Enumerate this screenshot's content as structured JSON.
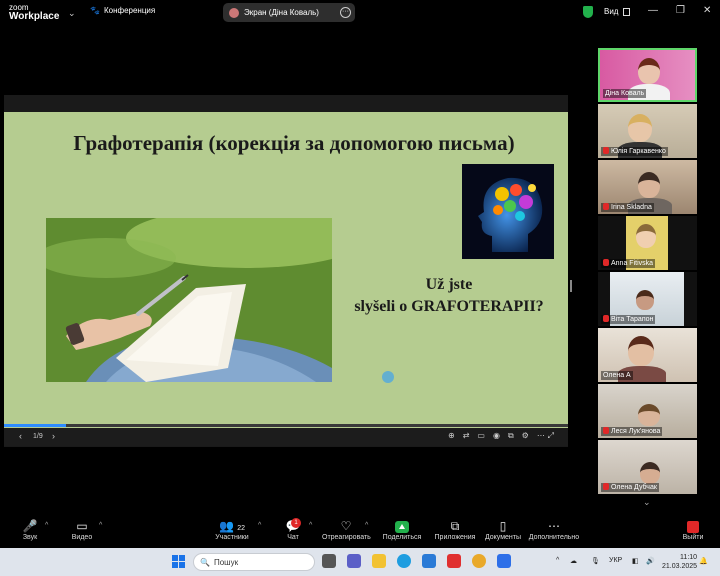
{
  "app": {
    "logo_line1": "zoom",
    "logo_line2": "Workplace",
    "meeting_label": "Конференция",
    "screen_share_label": "Экран (Діна Коваль)",
    "view_label": "Вид"
  },
  "slide": {
    "title": "Графотерапія (корекція за допомогою письма)",
    "question_line1": "Už jste",
    "question_line2": "slyšeli o GRAFOTERAPII?",
    "page_indicator": "1/9",
    "progress_fraction": 0.11
  },
  "participants": [
    {
      "name": "Діна Коваль",
      "muted": false,
      "active": true
    },
    {
      "name": "Юлія Гаркавенко",
      "muted": true,
      "active": false
    },
    {
      "name": "Irina Skladna",
      "muted": true,
      "active": false
    },
    {
      "name": "Anna Fitivska",
      "muted": true,
      "active": false
    },
    {
      "name": "Віта Тарапон",
      "muted": true,
      "active": false
    },
    {
      "name": "Олена А",
      "muted": false,
      "active": false
    },
    {
      "name": "Леся Лук'янова",
      "muted": true,
      "active": false
    },
    {
      "name": "Олена Дубчак",
      "muted": true,
      "active": false
    }
  ],
  "toolbar": {
    "audio": "Звук",
    "video": "Видео",
    "participants": "Участники",
    "participants_count": "22",
    "chat": "Чат",
    "chat_badge": "1",
    "react": "Отреагировать",
    "share": "Поделиться",
    "apps": "Приложения",
    "docs": "Документы",
    "more": "Дополнительно",
    "leave": "Выйти"
  },
  "taskbar": {
    "search_placeholder": "Пошук",
    "language": "УКР",
    "time": "11:10",
    "date": "21.03.2025"
  },
  "colors": {
    "slide_background": "#b5cc90",
    "active_speaker_border": "#5fd66a",
    "share_button": "#22b14c",
    "leave_button": "#e02828",
    "progress": "#2d8cff"
  }
}
